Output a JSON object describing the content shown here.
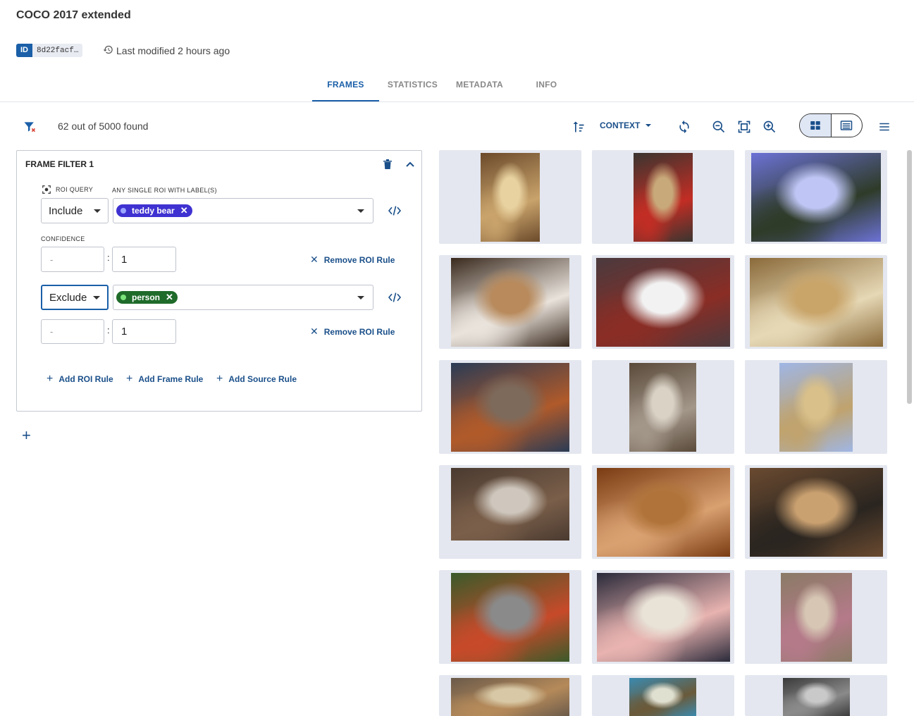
{
  "header": {
    "title": "COCO 2017 extended",
    "id_tag": "ID",
    "id_value": "8d22facf…",
    "last_modified": "Last modified 2 hours ago"
  },
  "tabs": [
    {
      "label": "FRAMES",
      "active": true
    },
    {
      "label": "STATISTICS",
      "active": false
    },
    {
      "label": "METADATA",
      "active": false
    },
    {
      "label": "INFO",
      "active": false
    }
  ],
  "toolbar": {
    "count_text": "62 out of 5000 found",
    "context_label": "CONTEXT"
  },
  "filter": {
    "title": "FRAME FILTER 1",
    "roi_query_label": "ROI QUERY",
    "label_hint": "ANY SINGLE ROI WITH LABEL(S)",
    "confidence_label": "CONFIDENCE",
    "rule1": {
      "mode": "Include",
      "chip": {
        "label": "teddy bear",
        "color": "#3f32d1",
        "dot": "#9aa6ff"
      },
      "conf_min_placeholder": "-",
      "conf_sep": ":",
      "conf_max": "1",
      "remove_label": "Remove ROI Rule"
    },
    "rule2": {
      "mode": "Exclude",
      "chip": {
        "label": "person",
        "color": "#1f6b2a",
        "dot": "#7be37b"
      },
      "conf_min_placeholder": "-",
      "conf_sep": ":",
      "conf_max": "1",
      "remove_label": "Remove ROI Rule"
    },
    "add_roi_rule": "Add ROI Rule",
    "add_frame_rule": "Add Frame Rule",
    "add_source_rule": "Add Source Rule"
  },
  "colors": {
    "accent": "#1a5fa8",
    "text_link": "#1a4f8a",
    "thumb_bg": "#e4e7ef"
  },
  "thumbnails": [
    {
      "name": "teddy-bear-toy-stand",
      "colors": [
        "#6b4a2b",
        "#e8d2a0",
        "#c9a36b"
      ]
    },
    {
      "name": "bear-with-red-bandana",
      "colors": [
        "#3a3530",
        "#c8a97a",
        "#c22d24"
      ]
    },
    {
      "name": "bear-in-tree-sky",
      "colors": [
        "#6c72d6",
        "#bfc6f5",
        "#2e3b28"
      ]
    },
    {
      "name": "bears-in-sled",
      "colors": [
        "#3a2a1e",
        "#b88a5c",
        "#e9e3dc"
      ]
    },
    {
      "name": "white-bear-pillows",
      "colors": [
        "#4a3a3e",
        "#f2f2f2",
        "#8a2d25"
      ]
    },
    {
      "name": "brown-plush-closeup",
      "colors": [
        "#8a6a3a",
        "#c9a56a",
        "#e6d8b5"
      ]
    },
    {
      "name": "cat-on-desk",
      "colors": [
        "#2a3b55",
        "#7d6a5b",
        "#b05a2a"
      ]
    },
    {
      "name": "bears-on-bed",
      "colors": [
        "#5a4a3a",
        "#d9d2c5",
        "#a3978a"
      ]
    },
    {
      "name": "yellow-bear-lace",
      "colors": [
        "#9fb6e5",
        "#d9c08a",
        "#c0a36d"
      ]
    },
    {
      "name": "living-room-shelf",
      "colors": [
        "#4a3a30",
        "#cfc7bd",
        "#7a5f4a"
      ]
    },
    {
      "name": "bear-in-cabinet",
      "colors": [
        "#7a3b12",
        "#b0743a",
        "#d9a070"
      ]
    },
    {
      "name": "kitchen",
      "colors": [
        "#6a4a30",
        "#c9a070",
        "#2a2520"
      ]
    },
    {
      "name": "cat-with-toys",
      "colors": [
        "#3a5a2a",
        "#8a8a8a",
        "#c74a2a"
      ]
    },
    {
      "name": "bears-on-table",
      "colors": [
        "#2a2a3a",
        "#e9e3d7",
        "#e8b3b0"
      ]
    },
    {
      "name": "bear-on-sand",
      "colors": [
        "#8a7a65",
        "#d6c6b3",
        "#b57a8a"
      ]
    },
    {
      "name": "bears-pile",
      "colors": [
        "#6a5a4a",
        "#d8c8a5",
        "#b58a5a"
      ]
    },
    {
      "name": "toys-in-water",
      "colors": [
        "#3a8ab0",
        "#e0e0d0",
        "#6a5a3a"
      ]
    },
    {
      "name": "bathroom-bw",
      "colors": [
        "#3a3a3a",
        "#c9c9c9",
        "#8a8a8a"
      ]
    }
  ]
}
